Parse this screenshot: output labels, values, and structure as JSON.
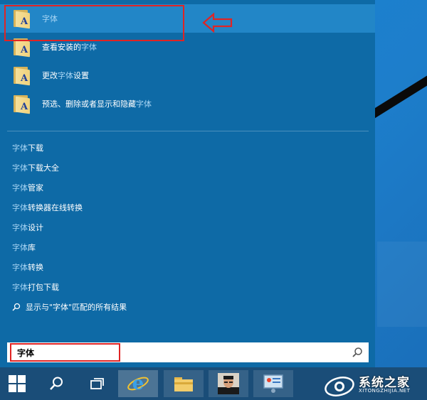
{
  "apps": [
    {
      "parts": [
        {
          "t": "字体",
          "hl": true
        }
      ]
    },
    {
      "parts": [
        {
          "t": "查看安装的",
          "hl": false
        },
        {
          "t": "字体",
          "hl": true
        }
      ]
    },
    {
      "parts": [
        {
          "t": "更改",
          "hl": false
        },
        {
          "t": "字体",
          "hl": true
        },
        {
          "t": "设置",
          "hl": false
        }
      ]
    },
    {
      "parts": [
        {
          "t": "预选、删除或者显示和隐藏",
          "hl": false
        },
        {
          "t": "字体",
          "hl": true
        }
      ]
    }
  ],
  "web_suggestions": [
    {
      "hl": "字体",
      "rest": "下载"
    },
    {
      "hl": "字体",
      "rest": "下载大全"
    },
    {
      "hl": "字体",
      "rest": "管家"
    },
    {
      "hl": "字体",
      "rest": "转换器在线转换"
    },
    {
      "hl": "字体",
      "rest": "设计"
    },
    {
      "hl": "字体",
      "rest": "库"
    },
    {
      "hl": "字体",
      "rest": "转换"
    },
    {
      "hl": "字体",
      "rest": "打包下载"
    }
  ],
  "search_all_label": "显示与\"字体\"匹配的所有结果",
  "search_box": {
    "value": "字体"
  },
  "folder_glyph": "A",
  "watermark": {
    "title": "系统之家",
    "url": "XITONGZHIJIA.NET"
  },
  "colors": {
    "highlight": "#a9d6f5",
    "annotation": "#e02424"
  }
}
